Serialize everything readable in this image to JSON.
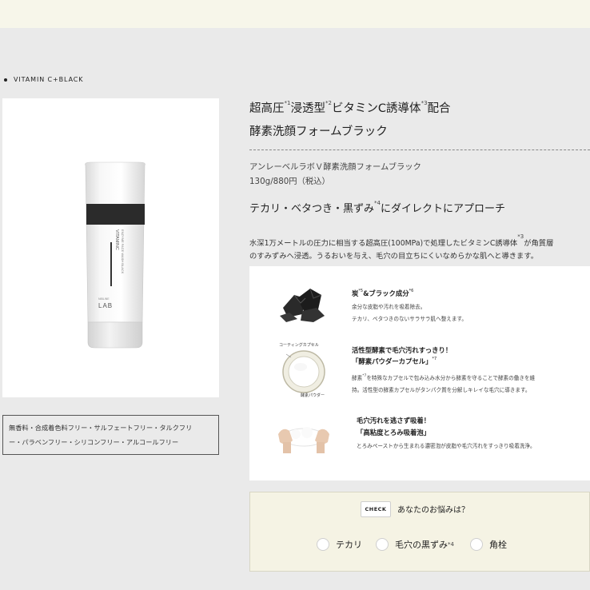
{
  "section_label": "VITAMIN C+BLACK",
  "tube": {
    "brand_line1": "VITAMINC",
    "brand_line2": "ENZYME FACE WASH BLACK",
    "logo_small": "NIBLINE",
    "logo": "LAB"
  },
  "features": {
    "line1": "無香料・合成着色料フリー・サルフェートフリー・タルクフリ",
    "line2": "ー・パラベンフリー・シリコンフリー・アルコールフリー"
  },
  "title": {
    "p1": "超高圧",
    "s1": "*1",
    "p2": "浸透型",
    "s2": "*2",
    "p3": "ビタミンC誘導体",
    "s3": "*3",
    "p4": "配合",
    "line2": "酵素洗顔フォームブラック"
  },
  "product_name": "アンレーベルラボＶ酵素洗顔フォームブラック",
  "price": "130g/880円（税込）",
  "tagline": {
    "p1": "テカリ・ベタつき・黒ずみ",
    "s1": "*4",
    "p2": "にダイレクトにアプローチ"
  },
  "description": {
    "line1_a": "水深1万メートルの圧力に相当する超高圧(100MPa)で処理したビタミンC誘導体",
    "line1_sup": "*3",
    "line1_b": "が角質層",
    "line2": "のすみずみへ浸透。うるおいを与え、毛穴の目立ちにくいなめらかな肌へと導きます。"
  },
  "ingredients": [
    {
      "title_a": "炭",
      "title_sup_a": "*5",
      "title_b": "&ブラック成分",
      "title_sup_b": "*6",
      "text1": "余分な皮脂や汚れを吸着除去。",
      "text2": "テカリ、ベタつきのないサラサラ肌へ整えます。"
    },
    {
      "title": "活性型酵素で毛穴汚れすっきり！",
      "title2": "「酵素パウダーカプセル」",
      "title2_sup": "*7",
      "text1_a": "酵素",
      "text1_sup": "*7",
      "text1_b": "を特殊なカプセルで包み込み水分から酵素を守ることで酵素の働きを維",
      "text2": "持。活性型の酵素カプセルがタンパク質を分解しキレイな毛穴に導きます。",
      "caption_top": "コーティングカプセル",
      "caption_bottom": "酵素パウダー"
    },
    {
      "title": "毛穴汚れを逃さず吸着！",
      "title2": "「高粘度とろみ吸着泡」",
      "text1": "とろみペーストから生まれる濃密泡が皮脂や毛穴汚れをすっきり吸着洗浄。"
    }
  ],
  "check": {
    "badge": "CHECK",
    "question": "あなたのお悩みは？",
    "options": [
      {
        "label": "テカリ",
        "sup": ""
      },
      {
        "label": "毛穴の黒ずみ",
        "sup": "*4"
      },
      {
        "label": "角栓",
        "sup": ""
      }
    ]
  },
  "colors": {
    "page_bg": "#eaeaea",
    "top_strip": "#f7f6ea",
    "check_panel": "#f5f3e4",
    "tube_band": "#2b2b2b"
  }
}
